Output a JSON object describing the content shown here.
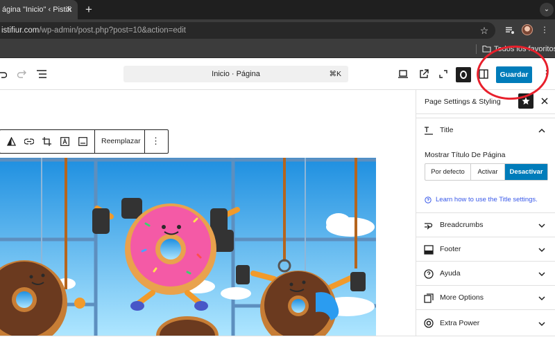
{
  "browser": {
    "tab_title": "ágina \"Inicio\" ‹ Pistifi",
    "tab_close_glyph": "✕",
    "new_tab_glyph": "+",
    "tab_menu_glyph": "⌄",
    "url_host": "istifiur.com",
    "url_path": "/wp-admin/post.php?post=10&action=edit",
    "bookmark_star_glyph": "☆",
    "menu_glyph": "⋮",
    "bookmarks_folder_label": "Todos los favoritos"
  },
  "editor_toolbar": {
    "document_title": "Inicio · Página",
    "shortcut": "⌘K",
    "save_label": "Guardar",
    "more_glyph": "⋮"
  },
  "block_toolbar": {
    "replace_label": "Reemplazar",
    "more_glyph": "⋮"
  },
  "sidebar": {
    "header_title": "Page Settings & Styling",
    "title_section": {
      "label": "Title",
      "field_label": "Mostrar Título De Página",
      "options": [
        "Por defecto",
        "Activar",
        "Desactivar"
      ],
      "selected": "Desactivar",
      "help_text": "Learn how to use the Title settings."
    },
    "sections": [
      {
        "label": "Breadcrumbs",
        "icon": "breadcrumbs-icon"
      },
      {
        "label": "Footer",
        "icon": "footer-icon"
      },
      {
        "label": "Ayuda",
        "icon": "help-circle-icon"
      },
      {
        "label": "More Options",
        "icon": "more-options-icon"
      },
      {
        "label": "Extra Power",
        "icon": "extra-power-icon"
      }
    ]
  },
  "colors": {
    "accent": "#007cba",
    "annotation_ring": "#e8202c",
    "link": "#3858e9"
  }
}
